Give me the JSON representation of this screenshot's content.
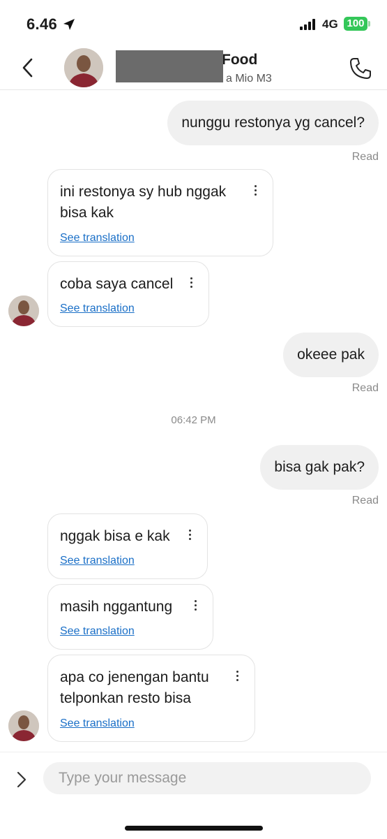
{
  "status_bar": {
    "time": "6.46",
    "network": "4G",
    "battery": "100"
  },
  "header": {
    "title_visible": "Food",
    "subtitle_visible": "a Mio M3"
  },
  "messages": {
    "out1": {
      "text": "nunggu restonya yg cancel?",
      "status": "Read"
    },
    "in1": {
      "text": "ini restonya sy hub nggak bisa kak",
      "translate": "See translation"
    },
    "in2": {
      "text": "coba saya cancel",
      "translate": "See translation"
    },
    "out2": {
      "text": "okeee pak",
      "status": "Read"
    },
    "timestamp": "06:42 PM",
    "out3": {
      "text": "bisa gak pak?",
      "status": "Read"
    },
    "in3": {
      "text": "nggak bisa e kak",
      "translate": "See translation"
    },
    "in4": {
      "text": "masih nggantung",
      "translate": "See translation"
    },
    "in5": {
      "text": "apa co jenengan bantu telponkan resto bisa",
      "translate": "See translation"
    }
  },
  "composer": {
    "placeholder": "Type your message"
  },
  "colors": {
    "battery": "#34c759",
    "link": "#1a6fc7",
    "outgoing_bubble": "#f0f0f0"
  },
  "icons": [
    "location-arrow-icon",
    "signal-icon",
    "back-chevron-icon",
    "phone-icon",
    "more-vertical-icon",
    "expand-chevron-icon"
  ]
}
